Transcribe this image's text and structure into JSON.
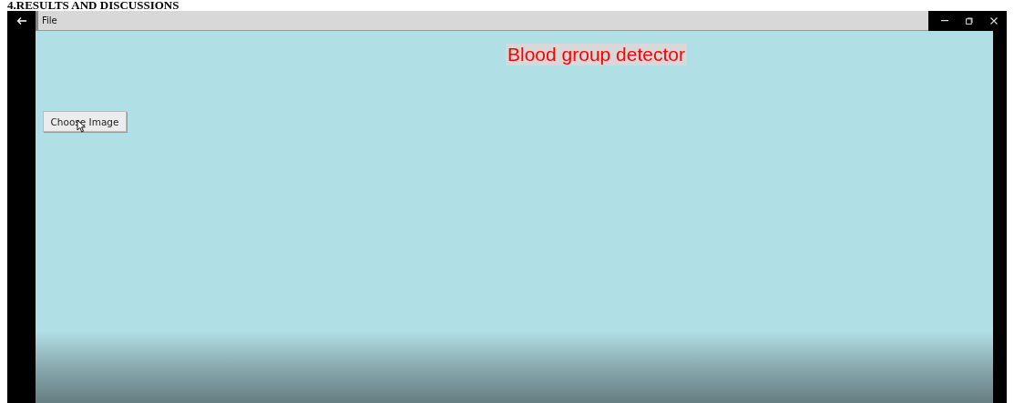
{
  "document_heading": "4.RESULTS AND DISCUSSIONS",
  "window": {
    "menu": [
      "File"
    ]
  },
  "app": {
    "title": "Blood group detector",
    "button": "Choose Image"
  }
}
